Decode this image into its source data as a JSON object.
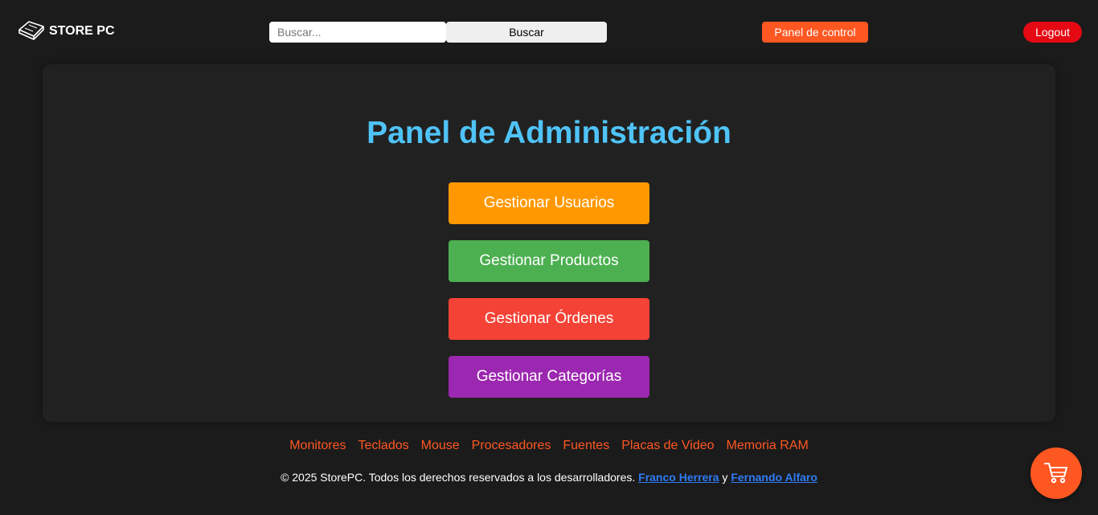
{
  "header": {
    "logo_text": "STORE PC",
    "search_placeholder": "Buscar...",
    "search_button": "Buscar",
    "panel_button": "Panel de control",
    "logout_button": "Logout"
  },
  "main": {
    "title": "Panel de Administración",
    "buttons": [
      {
        "label": "Gestionar Usuarios",
        "color": "#ff9800"
      },
      {
        "label": "Gestionar Productos",
        "color": "#4caf50"
      },
      {
        "label": "Gestionar Órdenes",
        "color": "#f44336"
      },
      {
        "label": "Gestionar Categorías",
        "color": "#9c27b0"
      }
    ]
  },
  "footer": {
    "links": [
      "Monitores",
      "Teclados",
      "Mouse",
      "Procesadores",
      "Fuentes",
      "Placas de Video",
      "Memoria RAM"
    ],
    "copyright_prefix": "© 2025 StorePC. Todos los derechos reservados a los desarrolladores.",
    "author1": "Franco Herrera",
    "connector": "y",
    "author2": "Fernando Alfaro"
  },
  "cart": {
    "icon": "shopping-cart-icon"
  },
  "colors": {
    "accent": "#ff5722",
    "title": "#4fc3f7",
    "logout": "#e50914",
    "author_link": "#2f7bf5"
  }
}
